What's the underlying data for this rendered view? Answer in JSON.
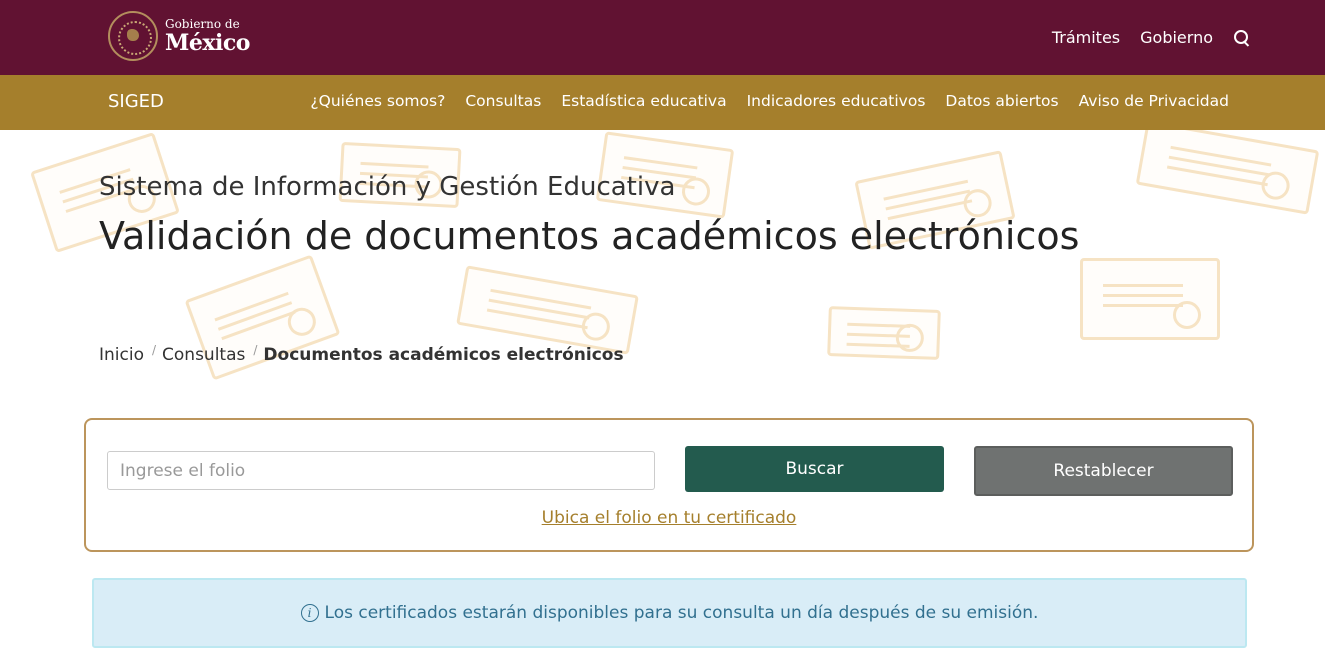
{
  "gov": {
    "logo_small": "Gobierno de",
    "logo_big": "México",
    "nav": [
      "Trámites",
      "Gobierno"
    ]
  },
  "subnav": {
    "brand": "SIGED",
    "items": [
      "¿Quiénes somos?",
      "Consultas",
      "Estadística educativa",
      "Indicadores educativos",
      "Datos abiertos",
      "Aviso de Privacidad"
    ]
  },
  "header": {
    "subtitle": "Sistema de Información y Gestión Educativa",
    "title": "Validación de documentos académicos electrónicos"
  },
  "breadcrumb": {
    "items": [
      "Inicio",
      "Consultas"
    ],
    "current": "Documentos académicos electrónicos",
    "separator": "/"
  },
  "search": {
    "placeholder": "Ingrese el folio",
    "value": "",
    "search_label": "Buscar",
    "reset_label": "Restablecer",
    "help_link": "Ubica el folio en tu certificado"
  },
  "alert": {
    "icon": "i",
    "text": "Los certificados estarán disponibles para su consulta un día después de su emisión."
  },
  "colors": {
    "gov_bar": "#611232",
    "sub_bar": "#a57f2c",
    "search_button": "#235b4e",
    "reset_button": "#6f7271",
    "card_border": "#bc955c",
    "alert_bg": "#d9edf7",
    "alert_text": "#31708f"
  },
  "icons": {
    "seal": "gobierno-mexico-seal-icon",
    "search": "search-icon",
    "info": "info-icon"
  }
}
